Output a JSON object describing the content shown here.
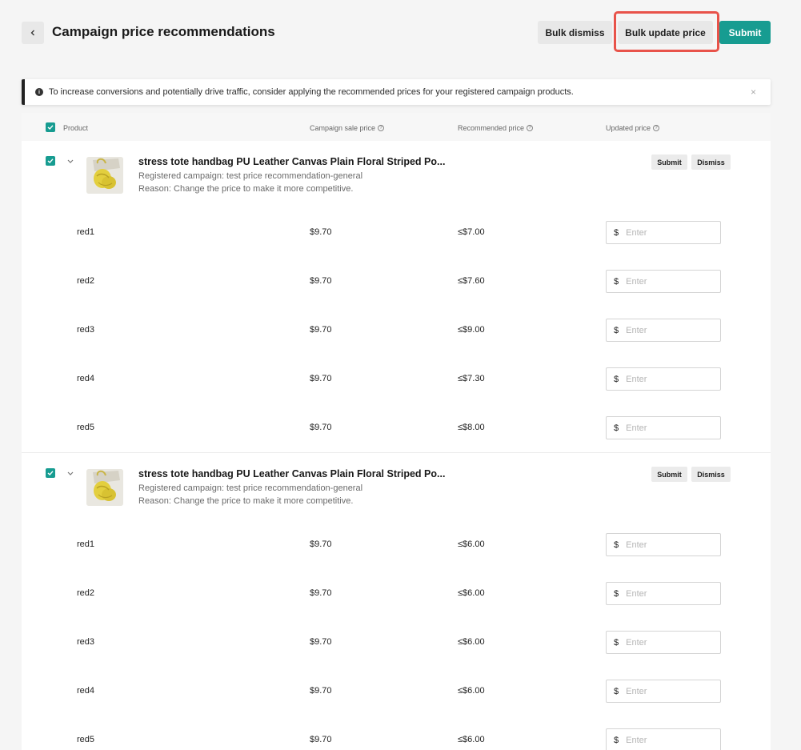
{
  "header": {
    "title": "Campaign price recommendations",
    "bulk_dismiss": "Bulk dismiss",
    "bulk_update_price": "Bulk update price",
    "submit": "Submit"
  },
  "banner": {
    "text": "To increase conversions and potentially drive traffic, consider applying the recommended prices for your registered campaign products.",
    "close": "×"
  },
  "table": {
    "columns": {
      "product": "Product",
      "campaign_sale_price": "Campaign sale price",
      "recommended_price": "Recommended price",
      "updated_price": "Updated price"
    }
  },
  "products": [
    {
      "name": "stress tote handbag PU Leather Canvas Plain Floral Striped Po...",
      "campaign": "Registered campaign: test price recommendation-general",
      "reason": "Reason: Change the price to make it more competitive.",
      "submit": "Submit",
      "dismiss": "Dismiss",
      "variants": [
        {
          "name": "red1",
          "sale": "$9.70",
          "rec": "≤$7.00",
          "currency": "$",
          "placeholder": "Enter"
        },
        {
          "name": "red2",
          "sale": "$9.70",
          "rec": "≤$7.60",
          "currency": "$",
          "placeholder": "Enter"
        },
        {
          "name": "red3",
          "sale": "$9.70",
          "rec": "≤$9.00",
          "currency": "$",
          "placeholder": "Enter"
        },
        {
          "name": "red4",
          "sale": "$9.70",
          "rec": "≤$7.30",
          "currency": "$",
          "placeholder": "Enter"
        },
        {
          "name": "red5",
          "sale": "$9.70",
          "rec": "≤$8.00",
          "currency": "$",
          "placeholder": "Enter"
        }
      ]
    },
    {
      "name": "stress tote handbag PU Leather Canvas Plain Floral Striped Po...",
      "campaign": "Registered campaign: test price recommendation-general",
      "reason": "Reason: Change the price to make it more competitive.",
      "submit": "Submit",
      "dismiss": "Dismiss",
      "variants": [
        {
          "name": "red1",
          "sale": "$9.70",
          "rec": "≤$6.00",
          "currency": "$",
          "placeholder": "Enter"
        },
        {
          "name": "red2",
          "sale": "$9.70",
          "rec": "≤$6.00",
          "currency": "$",
          "placeholder": "Enter"
        },
        {
          "name": "red3",
          "sale": "$9.70",
          "rec": "≤$6.00",
          "currency": "$",
          "placeholder": "Enter"
        },
        {
          "name": "red4",
          "sale": "$9.70",
          "rec": "≤$6.00",
          "currency": "$",
          "placeholder": "Enter"
        },
        {
          "name": "red5",
          "sale": "$9.70",
          "rec": "≤$6.00",
          "currency": "$",
          "placeholder": "Enter"
        }
      ]
    }
  ],
  "colors": {
    "accent": "#179c91",
    "highlight": "#e8534a"
  }
}
